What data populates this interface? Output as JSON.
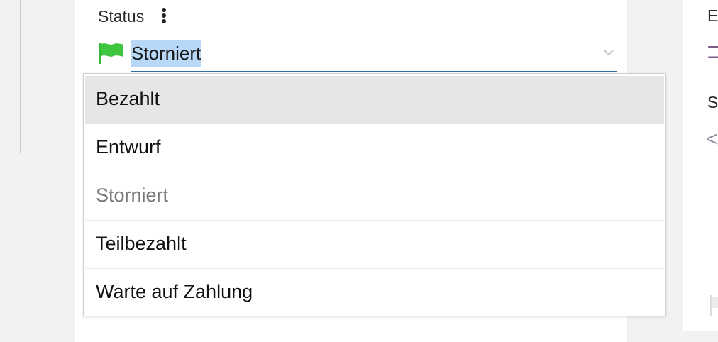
{
  "status_field": {
    "label": "Status",
    "selected_value": "Storniert",
    "flag_color": "#3fc53f",
    "underline_color": "#2f6fa4",
    "highlight_color": "#b8d8f7"
  },
  "dropdown": {
    "options": [
      {
        "label": "Bezahlt",
        "state": "hovered"
      },
      {
        "label": "Entwurf",
        "state": "normal"
      },
      {
        "label": "Storniert",
        "state": "disabled"
      },
      {
        "label": "Teilbezahlt",
        "state": "normal"
      },
      {
        "label": "Warte auf Zahlung",
        "state": "normal"
      }
    ]
  },
  "right_panel": {
    "label_1": "Ei",
    "label_2": "Sc"
  }
}
